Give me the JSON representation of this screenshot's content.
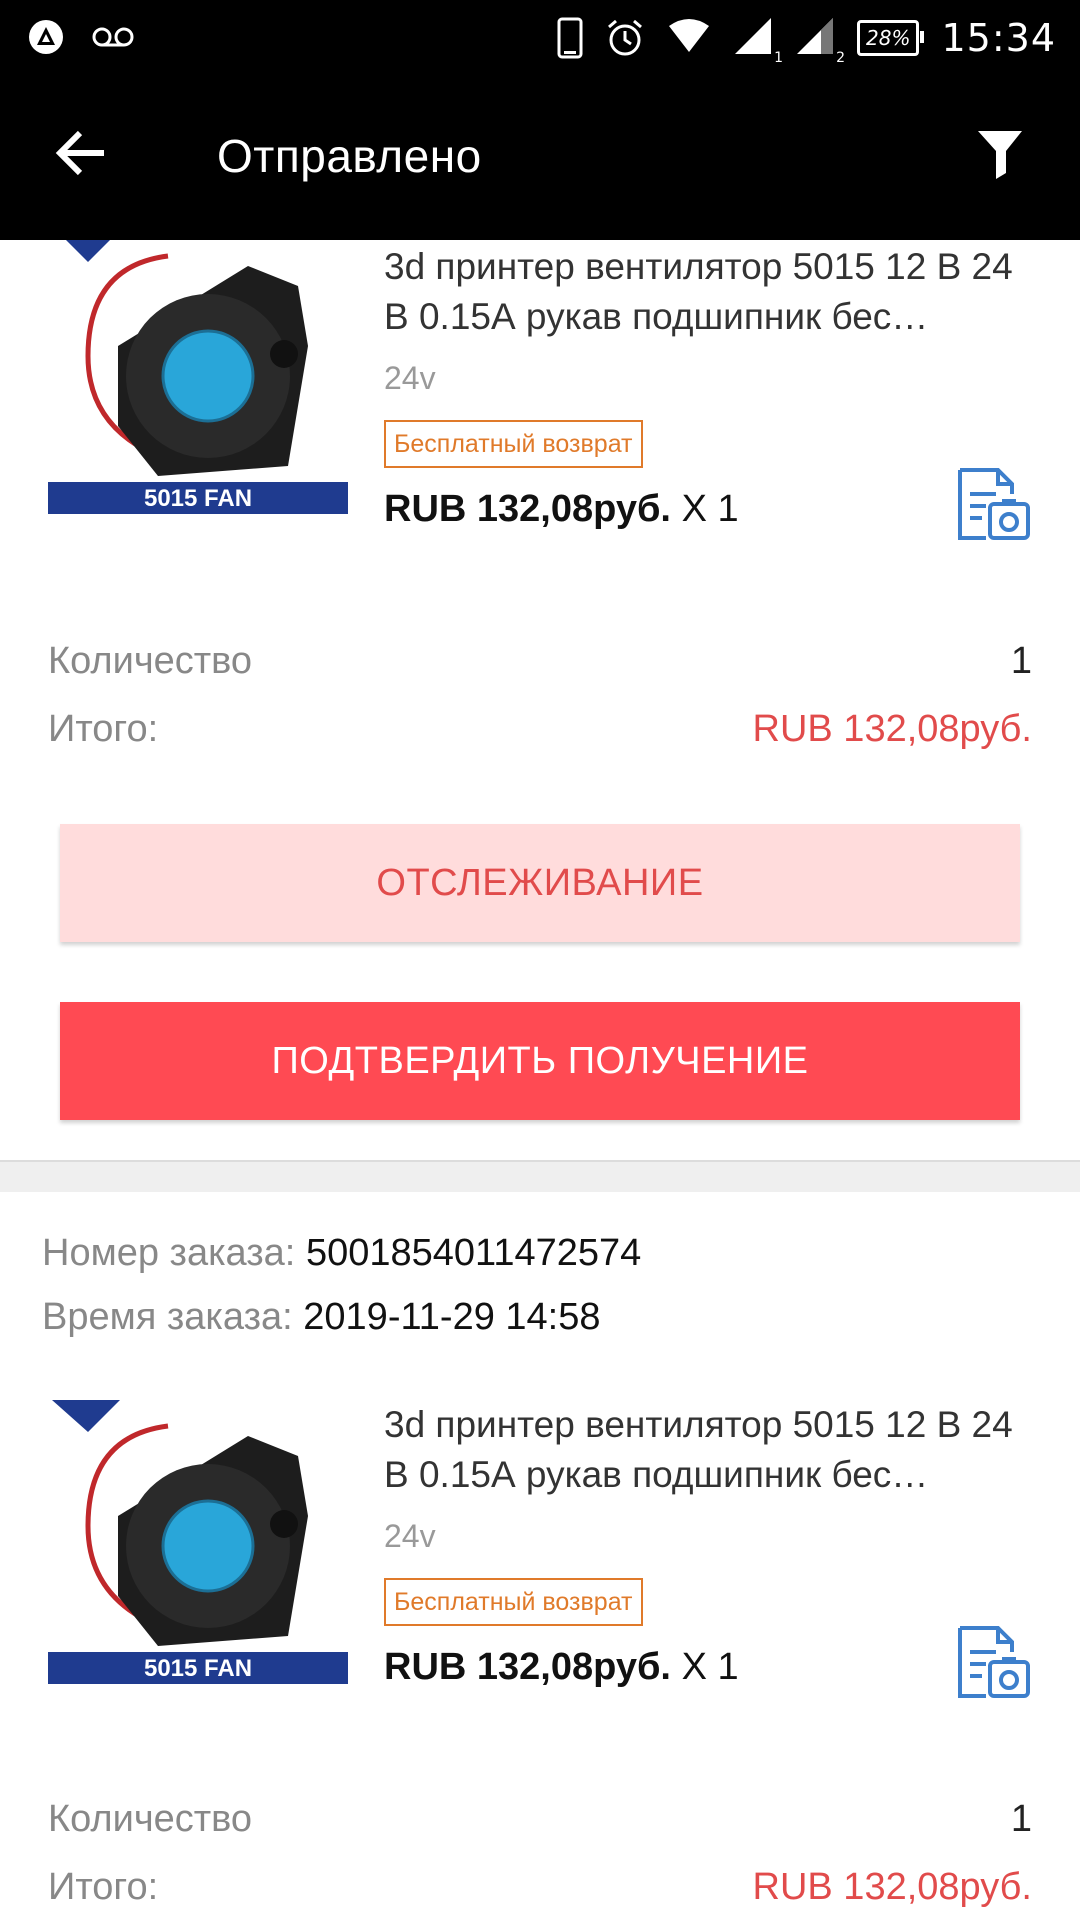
{
  "status_bar": {
    "time": "15:34",
    "battery": "28%",
    "sim1": "1",
    "sim2": "2",
    "icons": [
      "app-icon",
      "voicemail-icon",
      "phone-icon",
      "alarm-icon",
      "wifi-icon",
      "signal-icon",
      "signal-icon",
      "battery-icon"
    ]
  },
  "app_bar": {
    "title": "Отправлено",
    "back_icon": "arrow-left-icon",
    "filter_icon": "filter-icon"
  },
  "orders": [
    {
      "product": {
        "title": "3d принтер вентилятор 5015 12 В 24 В 0.15А рукав подшипник бес…",
        "variant": "24v",
        "badge": "Бесплатный возврат",
        "price": "RUB 132,08руб.",
        "qty_text": "X 1",
        "image_label": "5015 FAN"
      },
      "quantity_label": "Количество",
      "quantity_value": "1",
      "total_label": "Итого:",
      "total_value": "RUB 132,08руб.",
      "track_button": "ОТСЛЕЖИВАНИЕ",
      "confirm_button": "ПОДТВЕРДИТЬ ПОЛУЧЕНИЕ"
    },
    {
      "order_number_label": "Номер заказа:",
      "order_number": "5001854011472574",
      "order_time_label": "Время заказа:",
      "order_time": "2019-11-29 14:58",
      "product": {
        "title": "3d принтер вентилятор 5015 12 В 24 В 0.15А рукав подшипник бес…",
        "variant": "24v",
        "badge": "Бесплатный возврат",
        "price": "RUB 132,08руб.",
        "qty_text": "X 1",
        "image_label": "5015 FAN"
      },
      "quantity_label": "Количество",
      "quantity_value": "1",
      "total_label": "Итого:",
      "total_value": "RUB 132,08руб."
    }
  ],
  "colors": {
    "accent_red": "#ff4a53",
    "price_red": "#e14b4b",
    "badge_orange": "#e07a2a",
    "icon_blue": "#3d7fcc",
    "track_bg": "#ffdcdc"
  }
}
